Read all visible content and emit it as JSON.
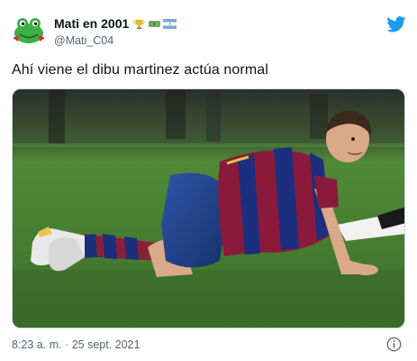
{
  "tweet": {
    "author": {
      "display_name": "Mati en 2001",
      "handle": "@Mati_C04",
      "avatar_icon": "frog-avatar-icon",
      "name_emojis": [
        "trophy-icon",
        "money-icon",
        "argentina-flag-icon"
      ]
    },
    "text": "Ahí viene el dibu martinez actúa normal",
    "timestamp": "8:23 a. m. · 25 sept. 2021",
    "media": {
      "description_icon": "photo-icon"
    }
  },
  "colors": {
    "twitter_blue": "#1d9bf0",
    "text_primary": "#0f1419",
    "text_secondary": "#536471",
    "border": "#cfd9de"
  }
}
